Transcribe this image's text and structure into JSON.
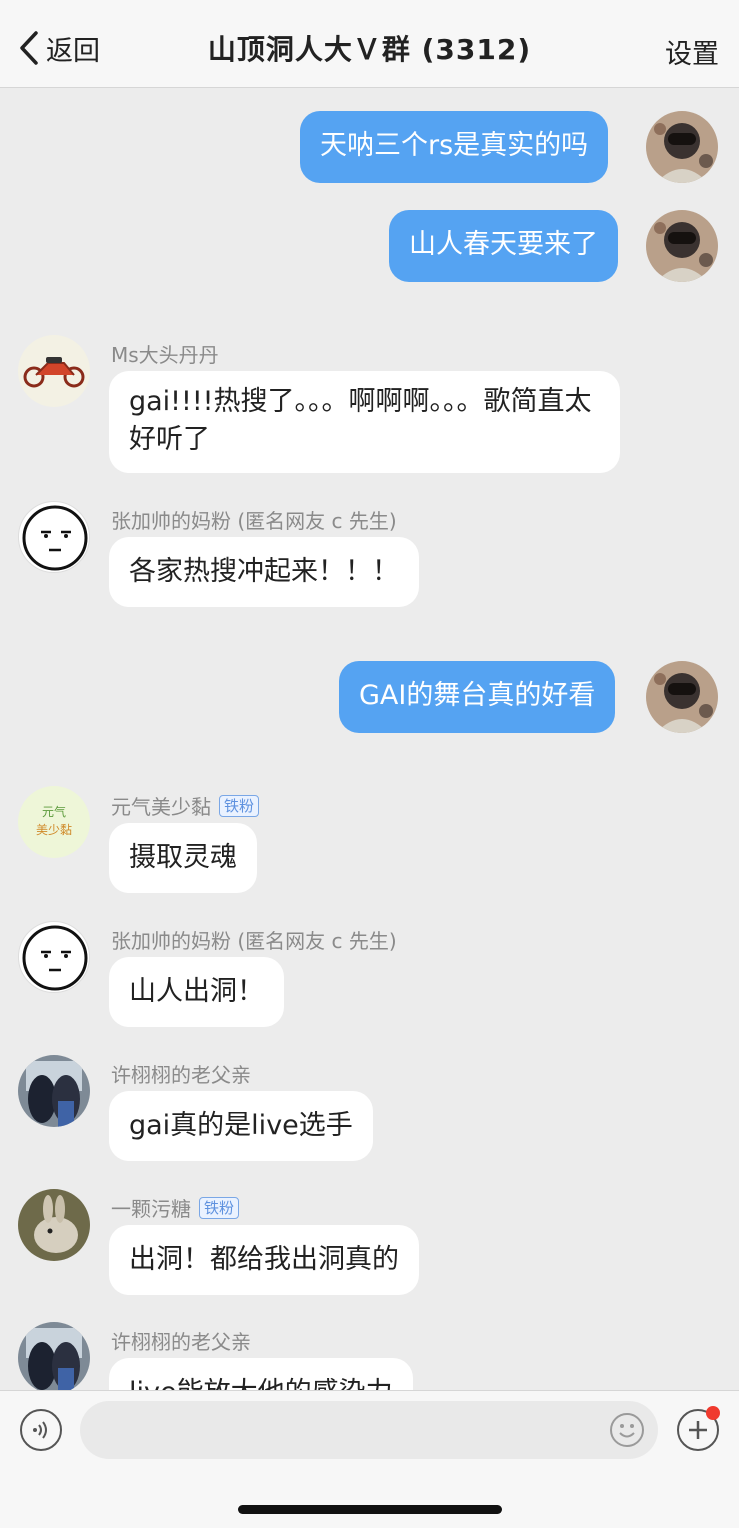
{
  "header": {
    "back_label": "返回",
    "title": "山顶洞人大Ｖ群 (3312)",
    "settings_label": "设置"
  },
  "messages": [
    {
      "sender": "self",
      "text": "天呐三个rs是真实的吗"
    },
    {
      "sender": "self",
      "text": "山人春天要来了"
    },
    {
      "sender": "other",
      "name": "Ms大头丹丹",
      "text": "gai!!!!热搜了。。。啊啊啊。。。歌简直太好听了",
      "avatar": "motorcycle-avatar"
    },
    {
      "sender": "other",
      "name": "张加帅的妈粉 (匿名网友 c 先生)",
      "text": "各家热搜冲起来！！！",
      "avatar": "face-sketch-avatar"
    },
    {
      "sender": "self",
      "text": "GAI的舞台真的好看"
    },
    {
      "sender": "other",
      "name": "元气美少黏",
      "badge": "铁粉",
      "text": "摄取灵魂",
      "avatar": "doodle-avatar"
    },
    {
      "sender": "other",
      "name": "张加帅的妈粉 (匿名网友 c 先生)",
      "text": "山人出洞！",
      "avatar": "face-sketch-avatar"
    },
    {
      "sender": "other",
      "name": "许栩栩的老父亲",
      "text": "gai真的是live选手",
      "avatar": "photo-avatar"
    },
    {
      "sender": "other",
      "name": "一颗污糖",
      "badge": "铁粉",
      "text": "出洞！都给我出洞真的",
      "avatar": "rabbit-avatar"
    },
    {
      "sender": "other",
      "name": "许栩栩的老父亲",
      "text": "live能放大他的感染力",
      "avatar": "photo-avatar"
    }
  ],
  "avatar_doodle_text": "元气美少黏",
  "input": {
    "placeholder": ""
  },
  "colors": {
    "my_bubble": "#55a3f2",
    "their_bubble": "#ffffff",
    "background": "#ececec",
    "notification_dot": "#f03a2e"
  }
}
